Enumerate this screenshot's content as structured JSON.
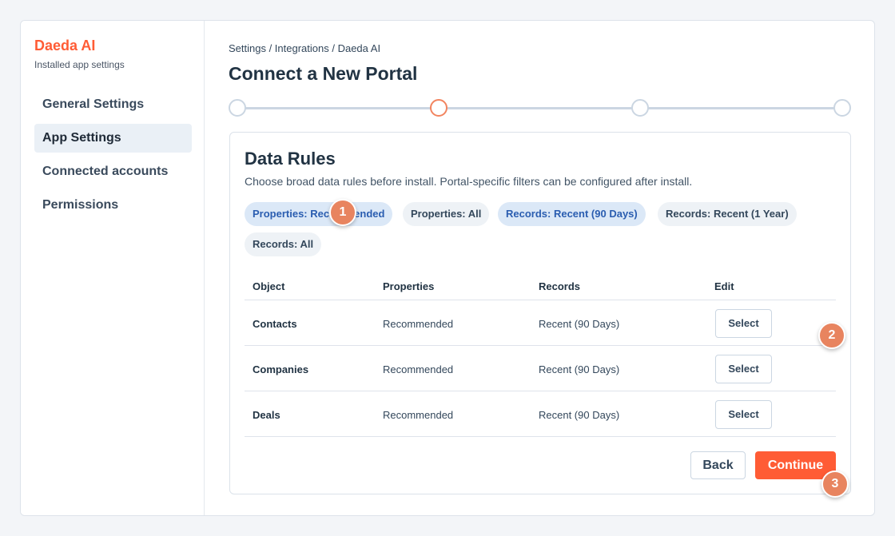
{
  "sidebar": {
    "brand": "Daeda AI",
    "subtitle": "Installed app settings",
    "items": [
      {
        "label": "General Settings"
      },
      {
        "label": "App Settings"
      },
      {
        "label": "Connected accounts"
      },
      {
        "label": "Permissions"
      }
    ],
    "active_index": 1
  },
  "main": {
    "breadcrumb": "Settings / Integrations / Daeda AI",
    "title": "Connect a New Portal",
    "stepper": {
      "steps": 4,
      "current_step": 2
    }
  },
  "card": {
    "title": "Data Rules",
    "description": "Choose broad data rules before install. Portal-specific filters can be configured after install.",
    "chips": [
      {
        "label": "Properties: Recommended",
        "selected": true
      },
      {
        "label": "Properties: All",
        "selected": false
      },
      {
        "label": "Records: Recent (90 Days)",
        "selected": true
      },
      {
        "label": "Records: Recent (1 Year)",
        "selected": false
      },
      {
        "label": "Records: All",
        "selected": false
      }
    ],
    "table": {
      "headers": {
        "object": "Object",
        "properties": "Properties",
        "records": "Records",
        "edit": "Edit"
      },
      "rows": [
        {
          "object": "Contacts",
          "properties": "Recommended",
          "records": "Recent (90 Days)",
          "edit": "Select"
        },
        {
          "object": "Companies",
          "properties": "Recommended",
          "records": "Recent (90 Days)",
          "edit": "Select"
        },
        {
          "object": "Deals",
          "properties": "Recommended",
          "records": "Recent (90 Days)",
          "edit": "Select"
        }
      ]
    },
    "back_label": "Back",
    "continue_label": "Continue"
  },
  "markers": [
    "1",
    "2",
    "3"
  ],
  "colors": {
    "accent": "#ff5c35",
    "marker": "#e8845f",
    "chip_selected": "#dbe8f7"
  }
}
